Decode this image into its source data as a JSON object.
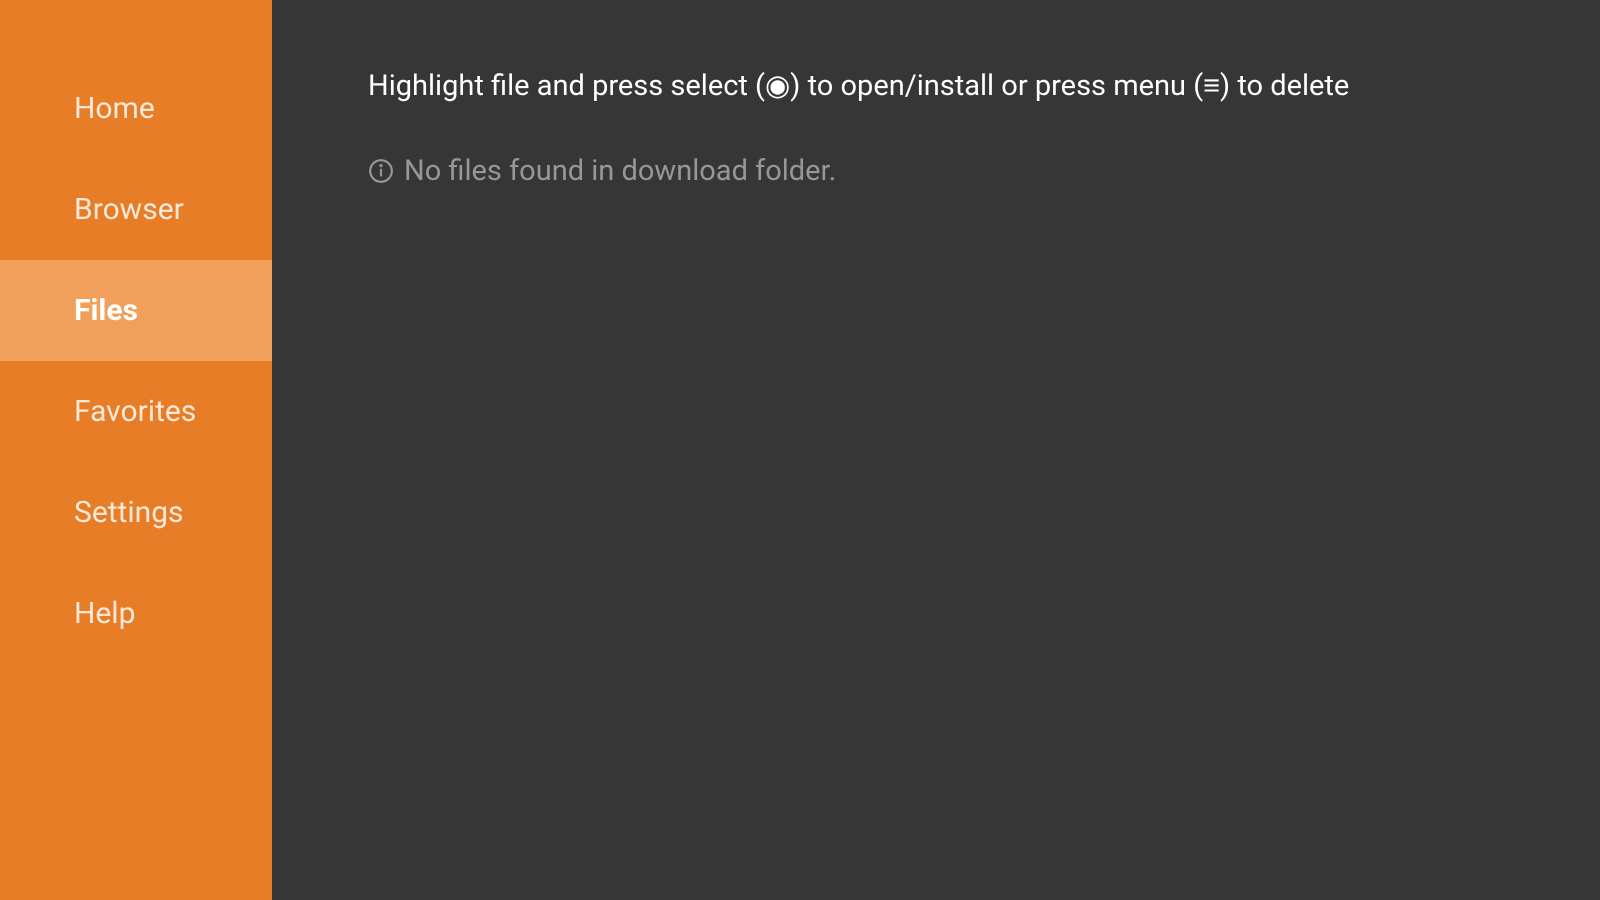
{
  "sidebar": {
    "items": [
      {
        "label": "Home",
        "active": false
      },
      {
        "label": "Browser",
        "active": false
      },
      {
        "label": "Files",
        "active": true
      },
      {
        "label": "Favorites",
        "active": false
      },
      {
        "label": "Settings",
        "active": false
      },
      {
        "label": "Help",
        "active": false
      }
    ]
  },
  "main": {
    "instruction": "Highlight file and press select (◉) to open/install or press menu (≡) to delete",
    "empty_message": "No files found in download folder."
  }
}
